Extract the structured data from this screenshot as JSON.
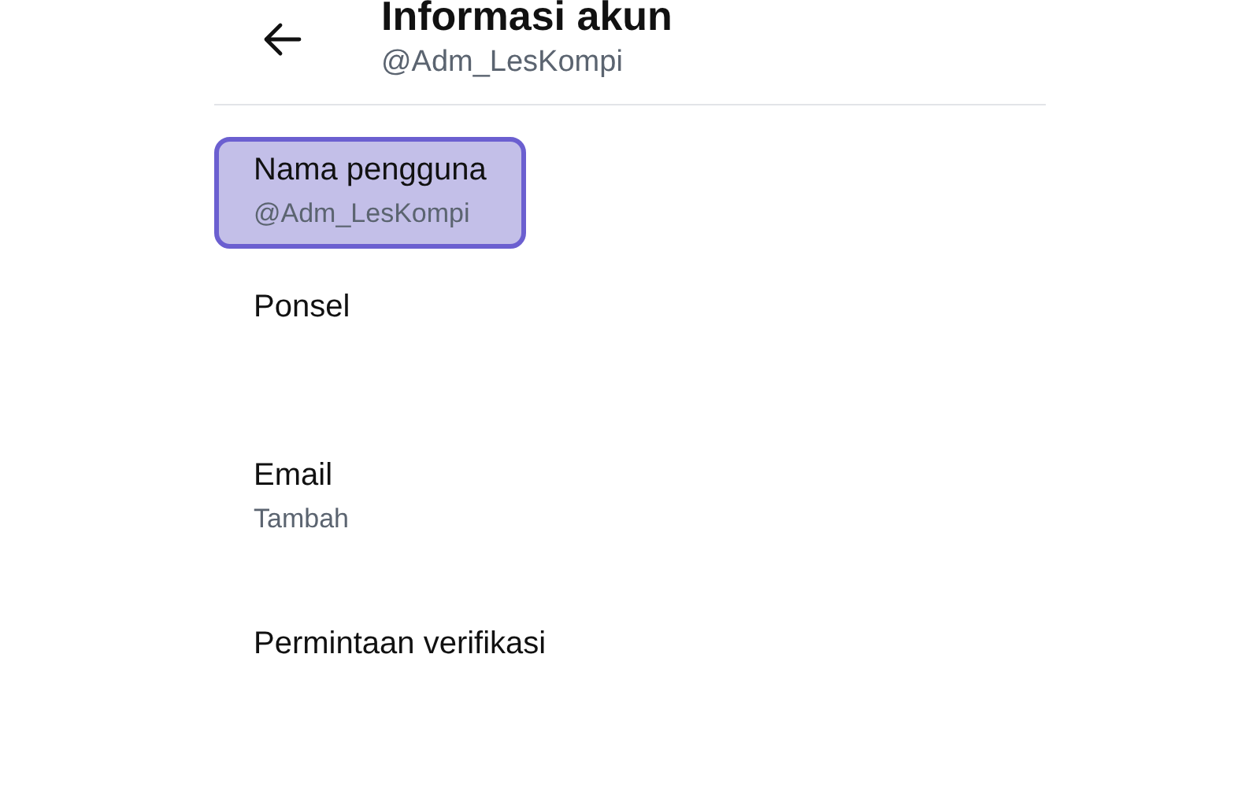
{
  "header": {
    "title": "Informasi akun",
    "subtitle": "@Adm_LesKompi"
  },
  "items": [
    {
      "label": "Nama pengguna",
      "value": "@Adm_LesKompi",
      "highlighted": true
    },
    {
      "label": "Ponsel",
      "highlighted": false
    },
    {
      "label": "Email",
      "value": "Tambah",
      "highlighted": false
    },
    {
      "label": "Permintaan verifikasi",
      "highlighted": false
    }
  ]
}
